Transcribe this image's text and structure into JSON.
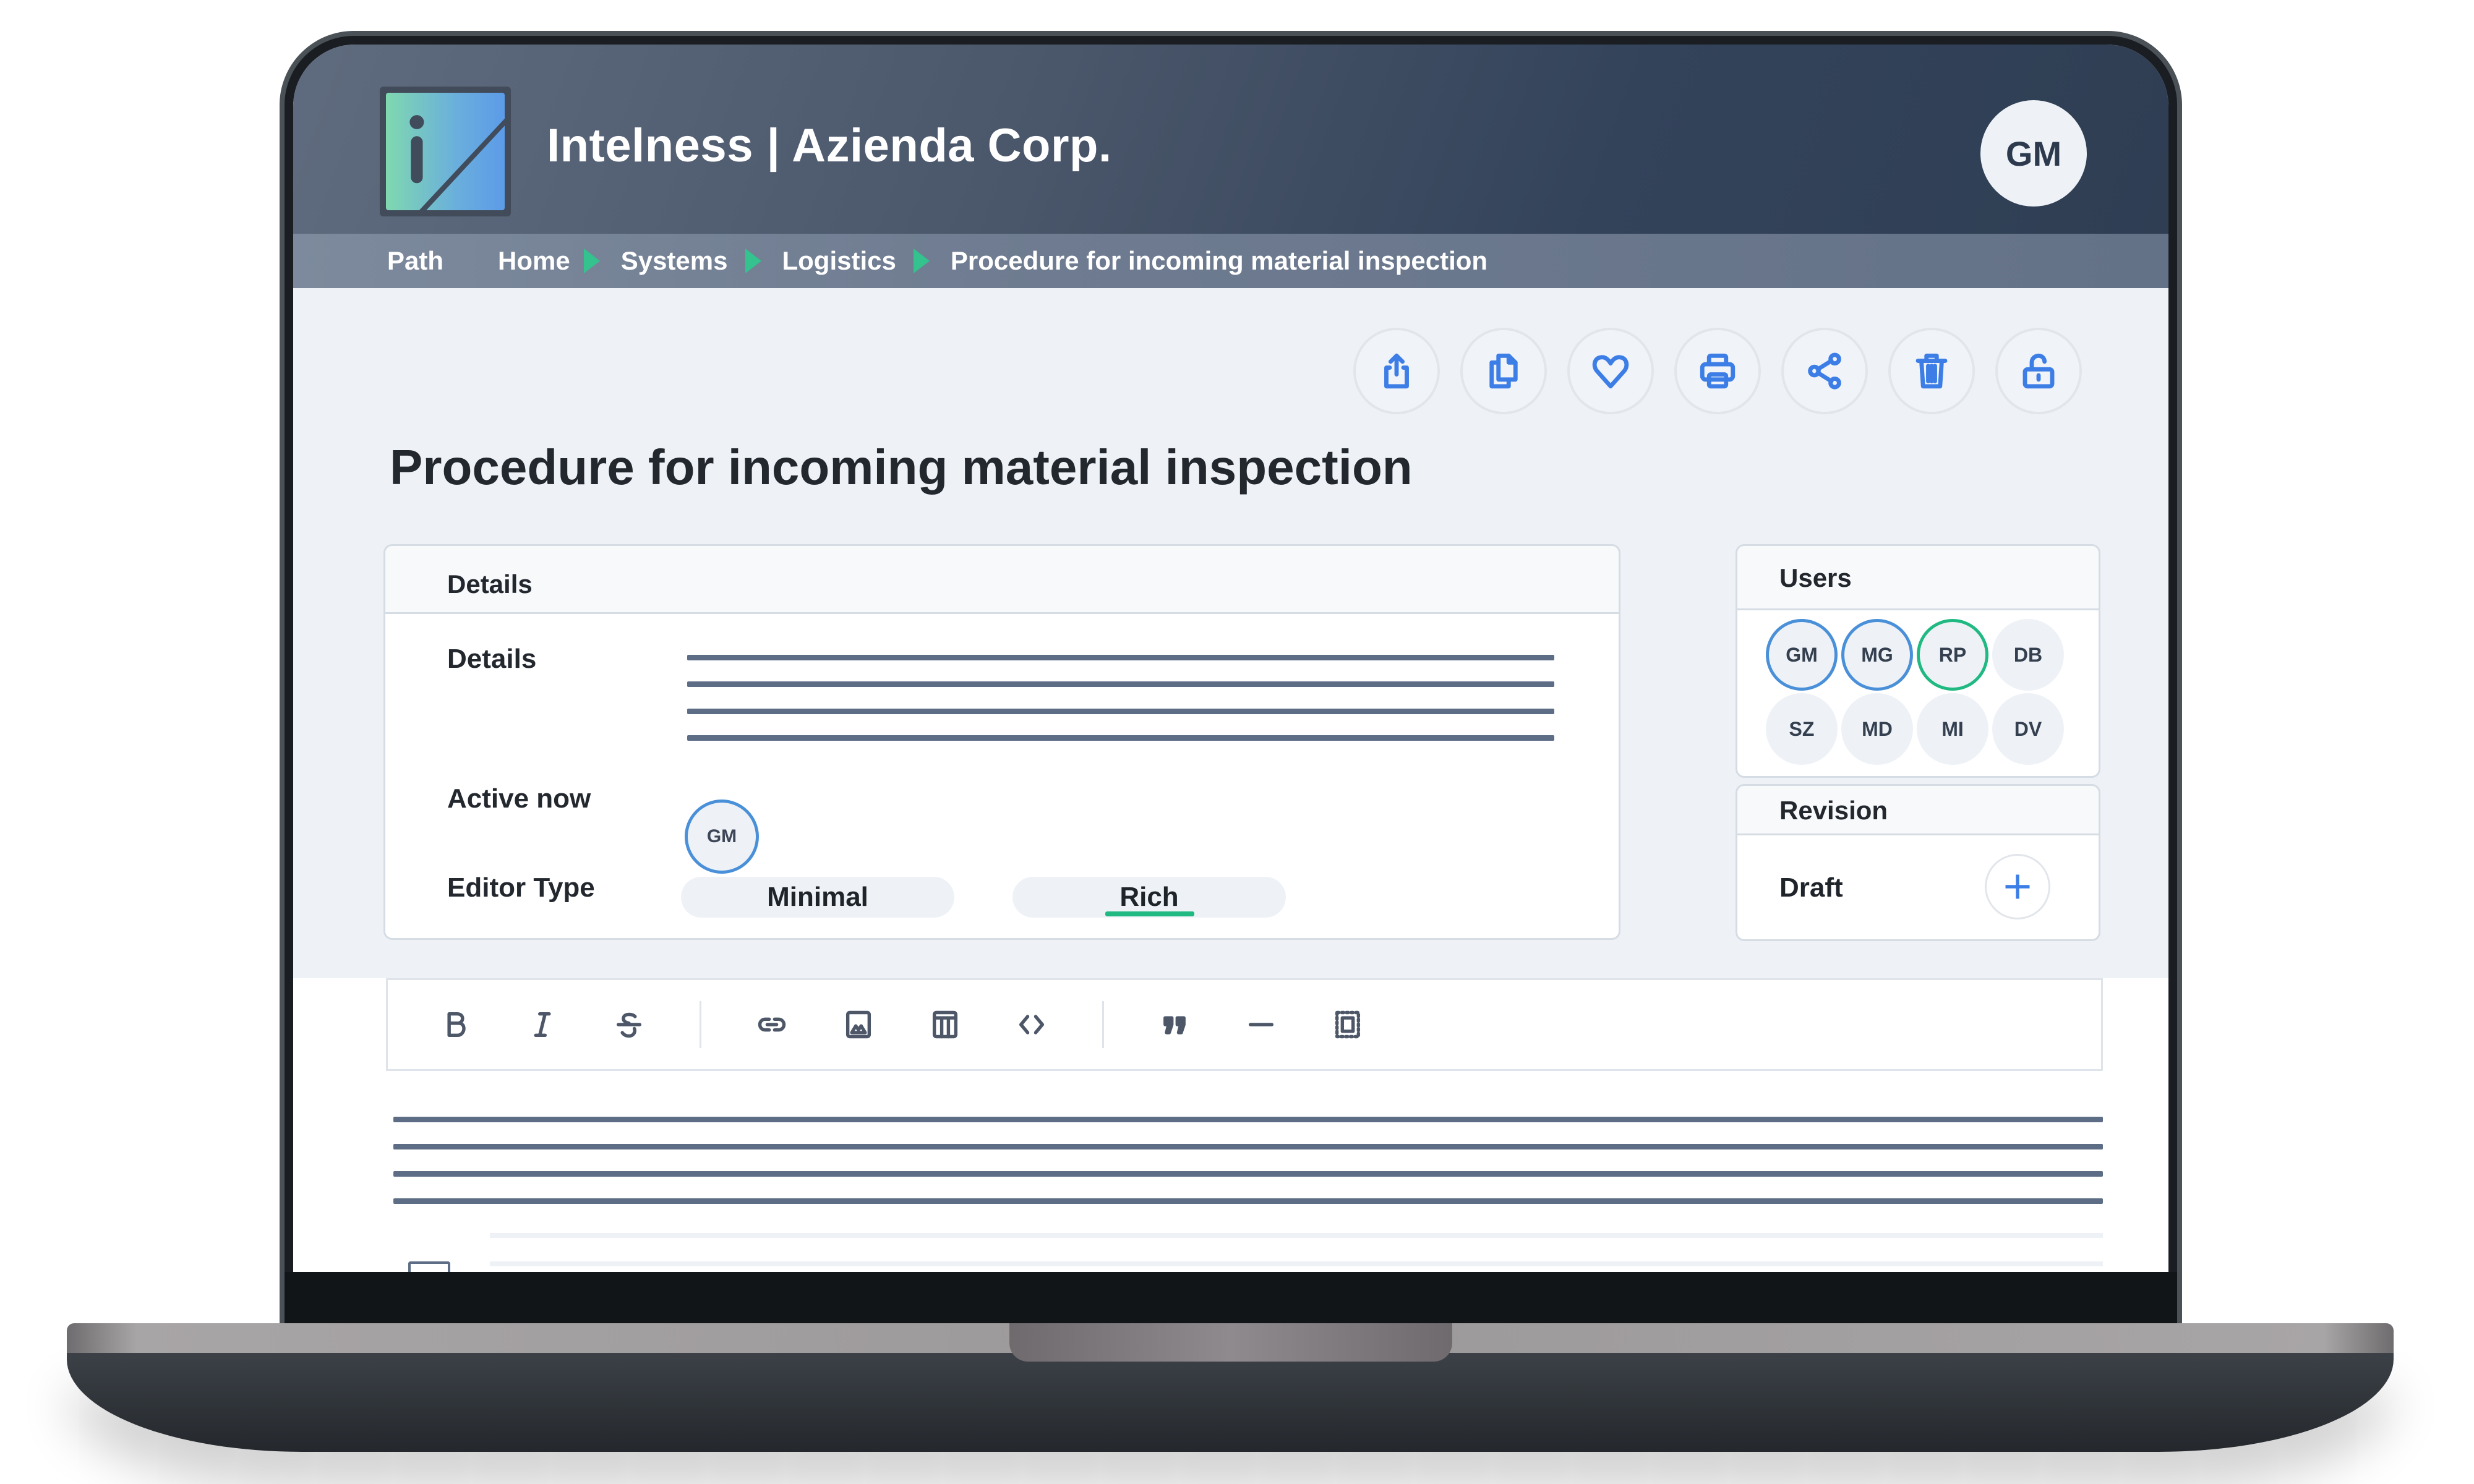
{
  "header": {
    "app_title": "Intelness | Azienda Corp.",
    "user_initials": "GM"
  },
  "breadcrumb": {
    "label": "Path",
    "items": [
      "Home",
      "Systems",
      "Logistics",
      "Procedure for incoming material inspection"
    ]
  },
  "actions": [
    {
      "name": "export",
      "icon": "share-upload-icon"
    },
    {
      "name": "duplicate",
      "icon": "copy-icon"
    },
    {
      "name": "favorite",
      "icon": "heart-icon"
    },
    {
      "name": "print",
      "icon": "printer-icon"
    },
    {
      "name": "share",
      "icon": "share-icon"
    },
    {
      "name": "delete",
      "icon": "trash-icon"
    },
    {
      "name": "unlock",
      "icon": "unlock-icon"
    }
  ],
  "page_title": "Procedure for incoming material inspection",
  "details": {
    "section_title": "Details",
    "details_label": "Details",
    "active_now_label": "Active now",
    "active_users": [
      "GM"
    ],
    "editor_type_label": "Editor Type",
    "editor_options": [
      "Minimal",
      "Rich"
    ],
    "editor_selected": "Rich"
  },
  "users": {
    "title": "Users",
    "list": [
      {
        "initials": "GM",
        "status": "blue"
      },
      {
        "initials": "MG",
        "status": "blue"
      },
      {
        "initials": "RP",
        "status": "green"
      },
      {
        "initials": "DB",
        "status": "none"
      },
      {
        "initials": "SZ",
        "status": "none"
      },
      {
        "initials": "MD",
        "status": "none"
      },
      {
        "initials": "MI",
        "status": "none"
      },
      {
        "initials": "DV",
        "status": "none"
      }
    ]
  },
  "revision": {
    "title": "Revision",
    "status": "Draft"
  },
  "editor_toolbar": {
    "groups": [
      [
        "bold",
        "italic",
        "strikethrough"
      ],
      [
        "link",
        "image",
        "table",
        "code"
      ],
      [
        "blockquote",
        "horizontal-rule",
        "select-all"
      ]
    ]
  },
  "colors": {
    "accent_blue": "#3d7ee6",
    "accent_green": "#20b981",
    "breadcrumb_arrow": "#34c28f",
    "header_dark": "#2f3e53"
  }
}
